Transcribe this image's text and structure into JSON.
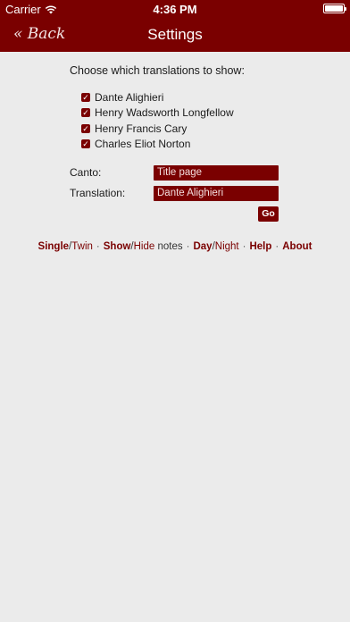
{
  "status_bar": {
    "carrier": "Carrier",
    "time": "4:36 PM",
    "battery_level": 1.0,
    "icons": [
      "wifi-icon",
      "battery-icon"
    ]
  },
  "nav": {
    "back_label": "« Back",
    "title": "Settings"
  },
  "settings": {
    "prompt": "Choose which translations to show:",
    "translations": [
      {
        "label": "Dante Alighieri",
        "checked": true
      },
      {
        "label": "Henry Wadsworth Longfellow",
        "checked": true
      },
      {
        "label": "Henry Francis Cary",
        "checked": true
      },
      {
        "label": "Charles Eliot Norton",
        "checked": true
      }
    ],
    "canto_label": "Canto:",
    "canto_value": "Title page",
    "translation_label": "Translation:",
    "translation_value": "Dante Alighieri",
    "go_label": "Go"
  },
  "options": {
    "single": "Single",
    "slash1": "/",
    "twin": "Twin",
    "show": "Show",
    "slash2": "/",
    "hide": "Hide",
    "notes": " notes",
    "day": "Day",
    "slash3": "/",
    "night": "Night",
    "help": "Help",
    "about": "About",
    "separator": "·"
  },
  "colors": {
    "accent": "#7a0000",
    "background": "#ebebeb"
  }
}
